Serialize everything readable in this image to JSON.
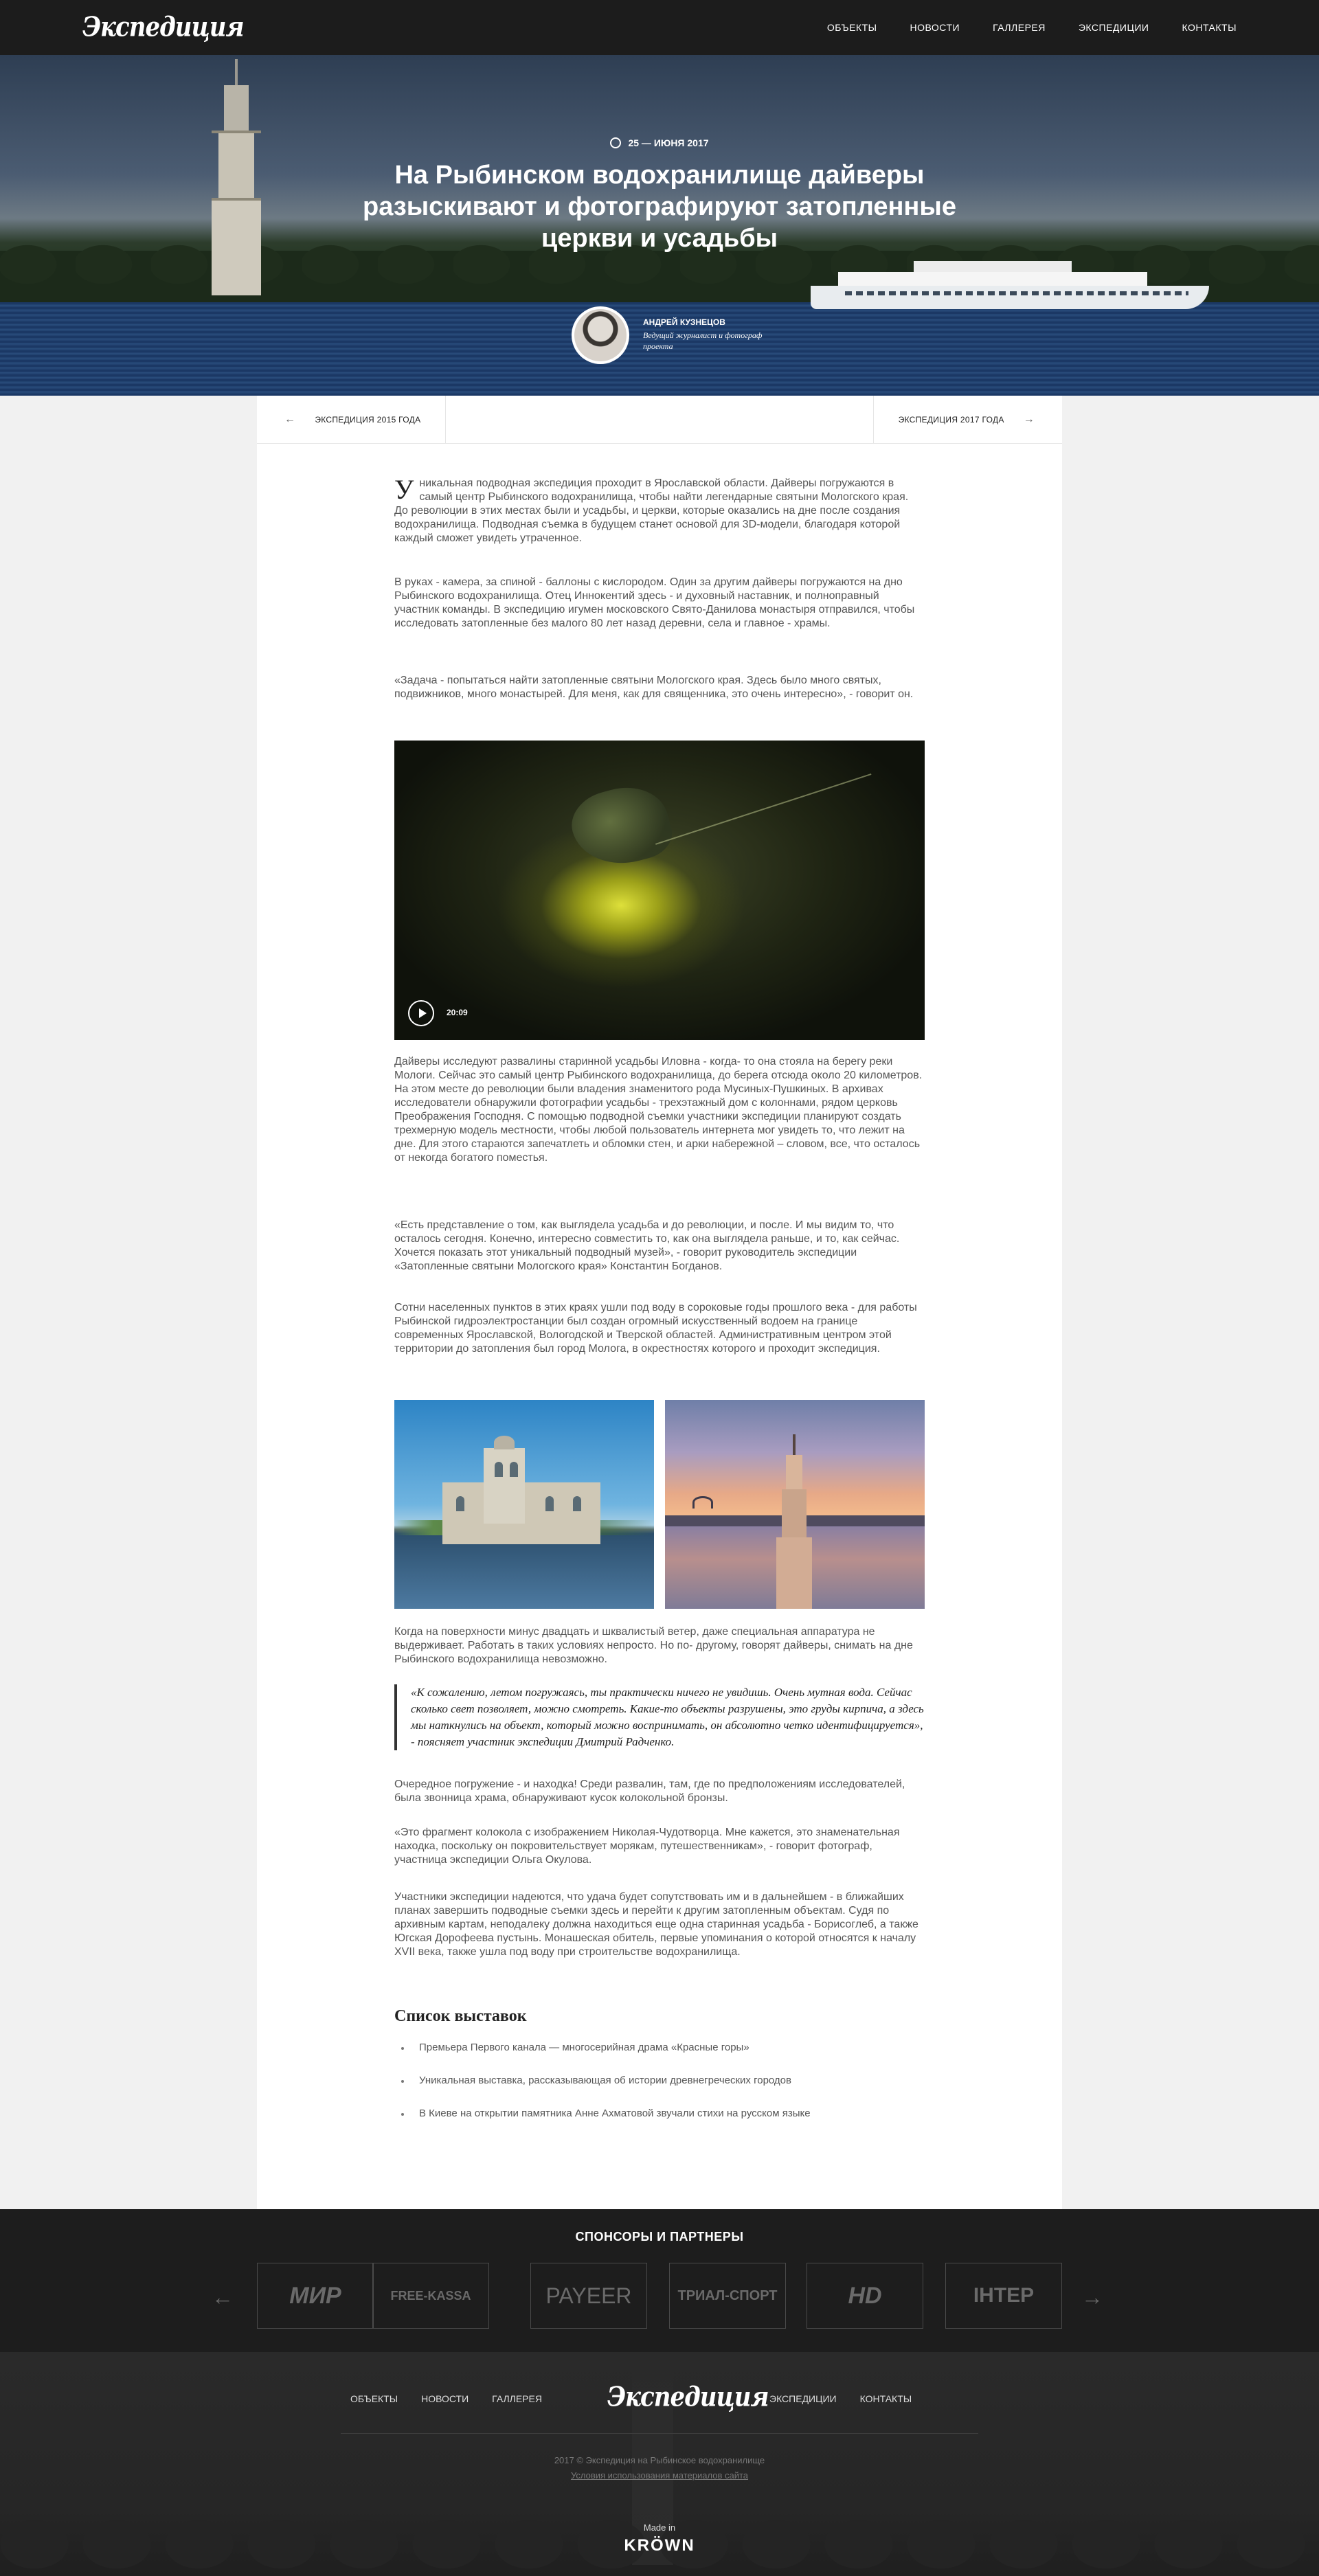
{
  "header": {
    "logo": "Экспедиция",
    "nav": [
      "ОБЪЕКТЫ",
      "НОВОСТИ",
      "ГАЛЛЕРЕЯ",
      "ЭКСПЕДИЦИИ",
      "КОНТАКТЫ"
    ]
  },
  "hero": {
    "date": "25 — ИЮНЯ 2017",
    "title": "На Рыбинском водохранилище дайверы разыскивают и фотографируют затопленные церкви и усадьбы",
    "author_name": "АНДРЕЙ КУЗНЕЦОВ",
    "author_role": "Ведущий журналист и фотограф проекта"
  },
  "post_nav": {
    "prev": "ЭКСПЕДИЦИЯ 2015 ГОДА",
    "next": "ЭКСПЕДИЦИЯ 2017 ГОДА"
  },
  "article": {
    "p1": "Уникальная подводная экспедиция проходит в Ярославской области. Дайверы погружаются в самый центр Рыбинского водохранилища, чтобы найти легендарные святыни Мологского края. До революции в этих местах были и усадьбы, и церкви, которые оказались на дне после создания водохранилища. Подводная съемка в будущем станет основой для 3D-модели, благодаря которой каждый сможет увидеть утраченное.",
    "p2": "В руках - камера, за спиной - баллоны с кислородом. Один за другим дайверы погружаются на дно Рыбинского водохранилища. Отец Иннокентий здесь - и духовный наставник, и полноправный участник команды. В экспедицию игумен московского Свято-Данилова монастыря отправился, чтобы исследовать затопленные без малого 80 лет назад деревни, села и главное - храмы.",
    "p3": "«Задача - попытаться найти затопленные святыни Мологского края. Здесь было много святых, подвижников, много монастырей. Для меня, как для священника, это очень интересно», - говорит он.",
    "video_time": "20:09",
    "p4": "Дайверы исследуют развалины старинной усадьбы Иловна - когда- то она стояла на берегу реки Мологи. Сейчас это самый центр Рыбинского водохранилища, до берега отсюда около 20 километров. На этом месте до революции были владения знаменитого рода Мусиных-Пушкиных. В архивах исследователи обнаружили фотографии усадьбы - трехэтажный дом с колоннами, рядом церковь Преображения Господня. С помощью подводной съемки участники экспедиции планируют создать трехмерную модель местности, чтобы любой пользователь интернета мог увидеть то, что лежит на дне. Для этого стараются запечатлеть и обломки стен, и арки набережной – словом, все, что осталось от некогда богатого поместья.",
    "p5": "«Есть представление о том, как выглядела усадьба и до революции, и после. И мы видим то, что осталось сегодня. Конечно, интересно совместить то, как она выглядела раньше, и то, как сейчас. Хочется показать этот уникальный подводный музей», - говорит руководитель экспедиции «Затопленные святыни Мологского края» Константин Богданов.",
    "p6": "Сотни населенных пунктов в этих краях ушли под воду в сороковые годы прошлого века - для работы Рыбинской гидроэлектростанции был создан огромный искусственный водоем на границе современных Ярославской, Вологодской и Тверской областей. Административным центром этой территории до затопления был город Молога, в окрестностях которого и проходит экспедиция.",
    "p7": "Когда на поверхности минус двадцать и шквалистый ветер, даже специальная аппаратура не выдерживает. Работать в таких условиях непросто. Но по- другому, говорят дайверы, снимать на дне Рыбинского водохранилища невозможно.",
    "quote": "«К сожалению, летом погружаясь, ты практически ничего не увидишь. Очень мутная вода. Сейчас сколько свет позволяет, можно смотреть. Какие-то объекты разрушены, это груды кирпича, а здесь мы наткнулись на объект, который можно воспринимать, он абсолютно четко идентифицируется», - поясняет участник экспедиции Дмитрий Радченко.",
    "p8": "Очередное погружение - и находка! Среди развалин, там, где по предположениям исследователей, была звонница храма, обнаруживают кусок колокольной бронзы.",
    "p9": "«Это фрагмент колокола с изображением Николая-Чудотворца. Мне кажется, это знаменательная находка, поскольку он покровительствует морякам, путешественникам», - говорит фотограф, участница экспедиции Ольга Окулова.",
    "p10": "Участники экспедиции надеются, что удача будет сопутствовать им и в дальнейшем - в ближайших планах завершить подводные съемки здесь и перейти к другим затопленным объектам. Судя по архивным картам, неподалеку должна находиться еще одна старинная усадьба - Борисоглеб, а также Югская Дорофеева пустынь. Монашеская обитель, первые упоминания о которой относятся к началу XVII века, также ушла под воду при строительстве водохранилища.",
    "list_title": "Список выставок",
    "list": [
      "Премьера Первого канала — многосерийная драма «Красные горы»",
      "Уникальная выставка, рассказывающая об истории древнегреческих городов",
      "В Киеве на открытии памятника Анне Ахматовой звучали стихи на русском языке"
    ]
  },
  "sponsors": {
    "title": "СПОНСОРЫ И ПАРТНЕРЫ",
    "logos": [
      "МИР",
      "FREE-KASSA",
      "PAYEER",
      "ТРИАЛ-СПОРТ",
      "HD",
      "ІНТЕР"
    ]
  },
  "footer": {
    "nav_left": [
      "ОБЪЕКТЫ",
      "НОВОСТИ",
      "ГАЛЛЕРЕЯ"
    ],
    "logo": "Экспедиция",
    "nav_right": [
      "ЭКСПЕДИЦИИ",
      "КОНТАКТЫ"
    ],
    "copyright": "2017 © Экспедиция на Рыбинское водохранилище",
    "terms": "Условия использования материалов сайта",
    "made_in": "Made in",
    "maker": "KRÖWN"
  }
}
